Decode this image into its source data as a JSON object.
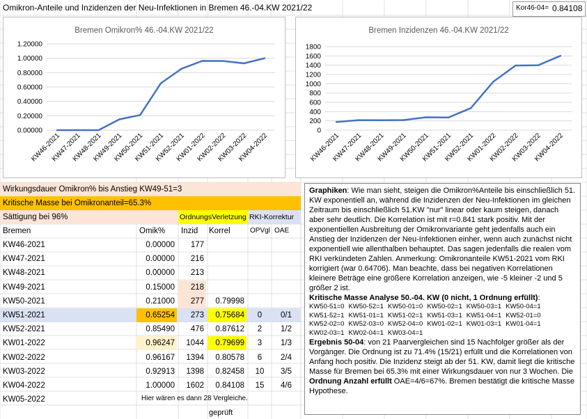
{
  "title": "Omikron-Anteile und Inzidenzen der Neu-Infektionen in Bremen 46.-04.KW 2021/22",
  "kor_label": "Kor46-04=",
  "kor_value": "0.84108",
  "chart_data": [
    {
      "type": "line",
      "title": "Bremen Omikron%  46.-04.KW 2021/22",
      "categories": [
        "KW46-2021",
        "KW47-2021",
        "KW48-2021",
        "KW49-2021",
        "KW50-2021",
        "KW51-2021",
        "KW52-2021",
        "KW01-2022",
        "KW02-2022",
        "KW03-2022",
        "KW04-2022"
      ],
      "values": [
        0,
        0,
        0,
        0.15,
        0.21,
        0.65254,
        0.8549,
        0.96247,
        0.96167,
        0.92913,
        1.0
      ],
      "ylim": [
        0,
        1.2
      ],
      "yticks": [
        "0.00000",
        "0.20000",
        "0.40000",
        "0.60000",
        "0.80000",
        "1.00000",
        "1.20000"
      ],
      "grid": true,
      "color": "#4472c4"
    },
    {
      "type": "line",
      "title": "Bremen Inzidenzen 46.-04.KW 2021/22",
      "categories": [
        "KW46-2021",
        "KW47-2021",
        "KW48-2021",
        "KW49-2021",
        "KW50-2021",
        "KW51-2021",
        "KW52-2021",
        "KW01-2022",
        "KW02-2022",
        "KW03-2022",
        "KW04-2022"
      ],
      "values": [
        177,
        216,
        213,
        218,
        277,
        273,
        476,
        1044,
        1394,
        1398,
        1602
      ],
      "ylim": [
        0,
        1800
      ],
      "yticks": [
        "0",
        "200",
        "400",
        "600",
        "800",
        "1000",
        "1200",
        "1400",
        "1600",
        "1800"
      ],
      "grid": true,
      "color": "#4472c4"
    }
  ],
  "banner1": "Wirkungsdauer Omikron% bis Anstieg KW49-51=3",
  "banner2": "Kritische Masse bei Omikronanteil=65.3%",
  "row_saett": {
    "label": "Sättigung bei 96%",
    "ordnung": "OrdnungsVerletzung",
    "rki": "RKI-Korrektur"
  },
  "headers": {
    "place": "Bremen",
    "omik": "Omik%",
    "inzid": "Inzid",
    "korrel": "Korrel",
    "opvgl": "OPVgl",
    "oae": "OAE"
  },
  "rows": [
    {
      "kw": "KW46-2021",
      "omik": "0.00000",
      "inz": "177",
      "kor": "",
      "op": "",
      "oae": ""
    },
    {
      "kw": "KW47-2021",
      "omik": "0.00000",
      "inz": "216",
      "kor": "",
      "op": "",
      "oae": ""
    },
    {
      "kw": "KW48-2021",
      "omik": "0.00000",
      "inz": "213",
      "kor": "",
      "op": "",
      "oae": ""
    },
    {
      "kw": "KW49-2021",
      "omik": "0.15000",
      "inz": "218",
      "kor": "",
      "op": "",
      "oae": ""
    },
    {
      "kw": "KW50-2021",
      "omik": "0.21000",
      "inz": "277",
      "kor": "0.79998",
      "op": "",
      "oae": ""
    },
    {
      "kw": "KW51-2021",
      "omik": "0.65254",
      "inz": "273",
      "kor": "0.75684",
      "op": "0",
      "oae": "0/1"
    },
    {
      "kw": "KW52-2021",
      "omik": "0.85490",
      "inz": "476",
      "kor": "0.87612",
      "op": "2",
      "oae": "1/2"
    },
    {
      "kw": "KW01-2022",
      "omik": "0.96247",
      "inz": "1044",
      "kor": "0.79699",
      "op": "3",
      "oae": "1/3"
    },
    {
      "kw": "KW02-2022",
      "omik": "0.96167",
      "inz": "1394",
      "kor": "0.80578",
      "op": "6",
      "oae": "2/4"
    },
    {
      "kw": "KW03-2022",
      "omik": "0.92913",
      "inz": "1398",
      "kor": "0.82458",
      "op": "10",
      "oae": "3/5"
    },
    {
      "kw": "KW04-2022",
      "omik": "1.00000",
      "inz": "1602",
      "kor": "0.84108",
      "op": "15",
      "oae": "4/6"
    },
    {
      "kw": "KW05-2022",
      "omik": "",
      "inz": "",
      "kor": "",
      "op": "",
      "oae": ""
    }
  ],
  "note_28": "Hier wären es dann 28 Vergleiche.",
  "note_geprueft": "geprüft",
  "textbox": {
    "p1_bold": "Graphiken",
    "p1": ": Wie man sieht, steigen die Omikron%Anteile bis einschließlich 51. KW exponentiell an, während die Inzidenzen der Neu-Infektionen im gleichen Zeitraum bis einschließlich 51.KW  \"nur\" linear oder kaum steigen, danach aber sehr deutlich. Die Korrelation ist mit r=0.841 stark positiv. Mit der exponentiellen Ausbreitung der Omikronvariante geht jedenfalls auch ein Anstieg der Inzidenzen der Neu-Infektionen einher, wenn auch zunächst nicht exponentiell wie allenthalben behauptet. Das sagen jedenfalls die realen vom RKI verkündeten Zahlen. Anmerkung: Omikronanteile KW51-2021 vom RKI korrigiert (war 0.64706). Man beachte, dass bei negativen Korrelationen kleinere Beträge eine größere Korrelation anzeigen, wie -5 kleiner -2 und 5 größer 2 ist.",
    "p2_bold": "Kritische Masse Analyse 50.-04. KW  (0 nicht, 1 Ordnung erfüllt)",
    "p2_end": ":",
    "matrix": [
      "KW50-51=0",
      "KW50-52=1",
      "KW50-01=0",
      "KW50-02=1",
      "KW50-03=1",
      "KW50-04=1",
      "KW51-52=1",
      "KW51-01=1",
      "KW51-02=1",
      "KW51-03=1",
      "KW51-04=1",
      "KW52-01=0",
      "KW52-02=0",
      "KW52-03=0",
      "KW52-04=0",
      "KW01-02=1",
      "KW01-03=1",
      "KW01-04=1",
      "KW02-03=1",
      "KW02-04=1",
      "KW03-04=1"
    ],
    "p3_bold": "Ergebnis 50-04",
    "p3a": ": von 21 Paarvergleichen sind 15 Nachfolger größer als der Vorgänger. Die Ordnung ist zu 71.4% (15/21) erfüllt und die Korrelationen von Anfang  hoch positiv.  Die Inzidenz steigt ab der 51. KW, damit liegt die kritische Masse für Bremen bei 65.3% mit einer Wirkungsdauer von nur 3 Wochen. Die ",
    "p3_bold2": "Ordnung Anzahl erfüllt",
    "p3b": " OAE=4/6=67%.  Bremen bestätigt die kritische Masse Hypothese."
  }
}
